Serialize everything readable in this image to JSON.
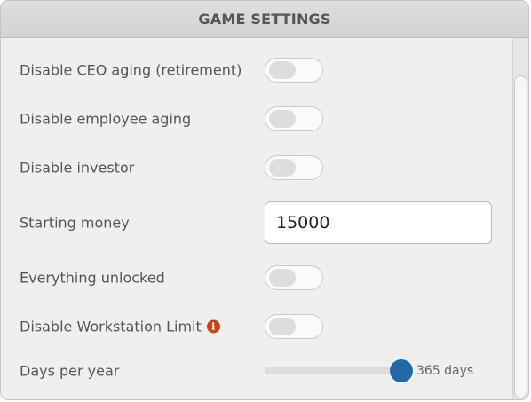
{
  "header": {
    "title": "GAME SETTINGS"
  },
  "settings": {
    "disable_ceo_aging": {
      "label": "Disable CEO aging (retirement)",
      "enabled": false
    },
    "disable_employee_aging": {
      "label": "Disable employee aging",
      "enabled": false
    },
    "disable_investor": {
      "label": "Disable investor",
      "enabled": false
    },
    "starting_money": {
      "label": "Starting money",
      "value": "15000"
    },
    "everything_unlocked": {
      "label": "Everything unlocked",
      "enabled": false
    },
    "disable_workstation_limit": {
      "label": "Disable Workstation Limit",
      "info_icon_glyph": "i",
      "enabled": false
    },
    "days_per_year": {
      "label": "Days per year",
      "value_text": "365 days",
      "slider_fraction": 1.0
    }
  },
  "colors": {
    "info_icon": "#c0471e",
    "slider_thumb": "#2168a7"
  },
  "icons": {
    "info": "info-icon"
  }
}
